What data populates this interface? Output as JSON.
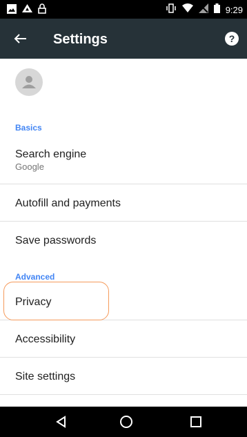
{
  "status_bar": {
    "time": "9:29",
    "left_icons": [
      "image-icon",
      "drive-icon",
      "lock-icon"
    ],
    "right_icons": [
      "vibrate-icon",
      "wifi-icon",
      "no-signal-icon",
      "battery-icon"
    ]
  },
  "app_bar": {
    "title": "Settings",
    "back_icon": "arrow-left-icon",
    "help_icon": "help-icon",
    "background": "#263238"
  },
  "sections": {
    "basics": "Basics",
    "advanced": "Advanced"
  },
  "items": {
    "search_engine": {
      "label": "Search engine",
      "value": "Google"
    },
    "autofill": {
      "label": "Autofill and payments"
    },
    "passwords": {
      "label": "Save passwords"
    },
    "privacy": {
      "label": "Privacy"
    },
    "accessibility": {
      "label": "Accessibility"
    },
    "site_settings": {
      "label": "Site settings"
    }
  },
  "nav_bar": [
    "back-triangle-icon",
    "home-circle-icon",
    "recents-square-icon"
  ],
  "colors": {
    "accent": "#4285f4",
    "highlight": "#f59a5a"
  }
}
